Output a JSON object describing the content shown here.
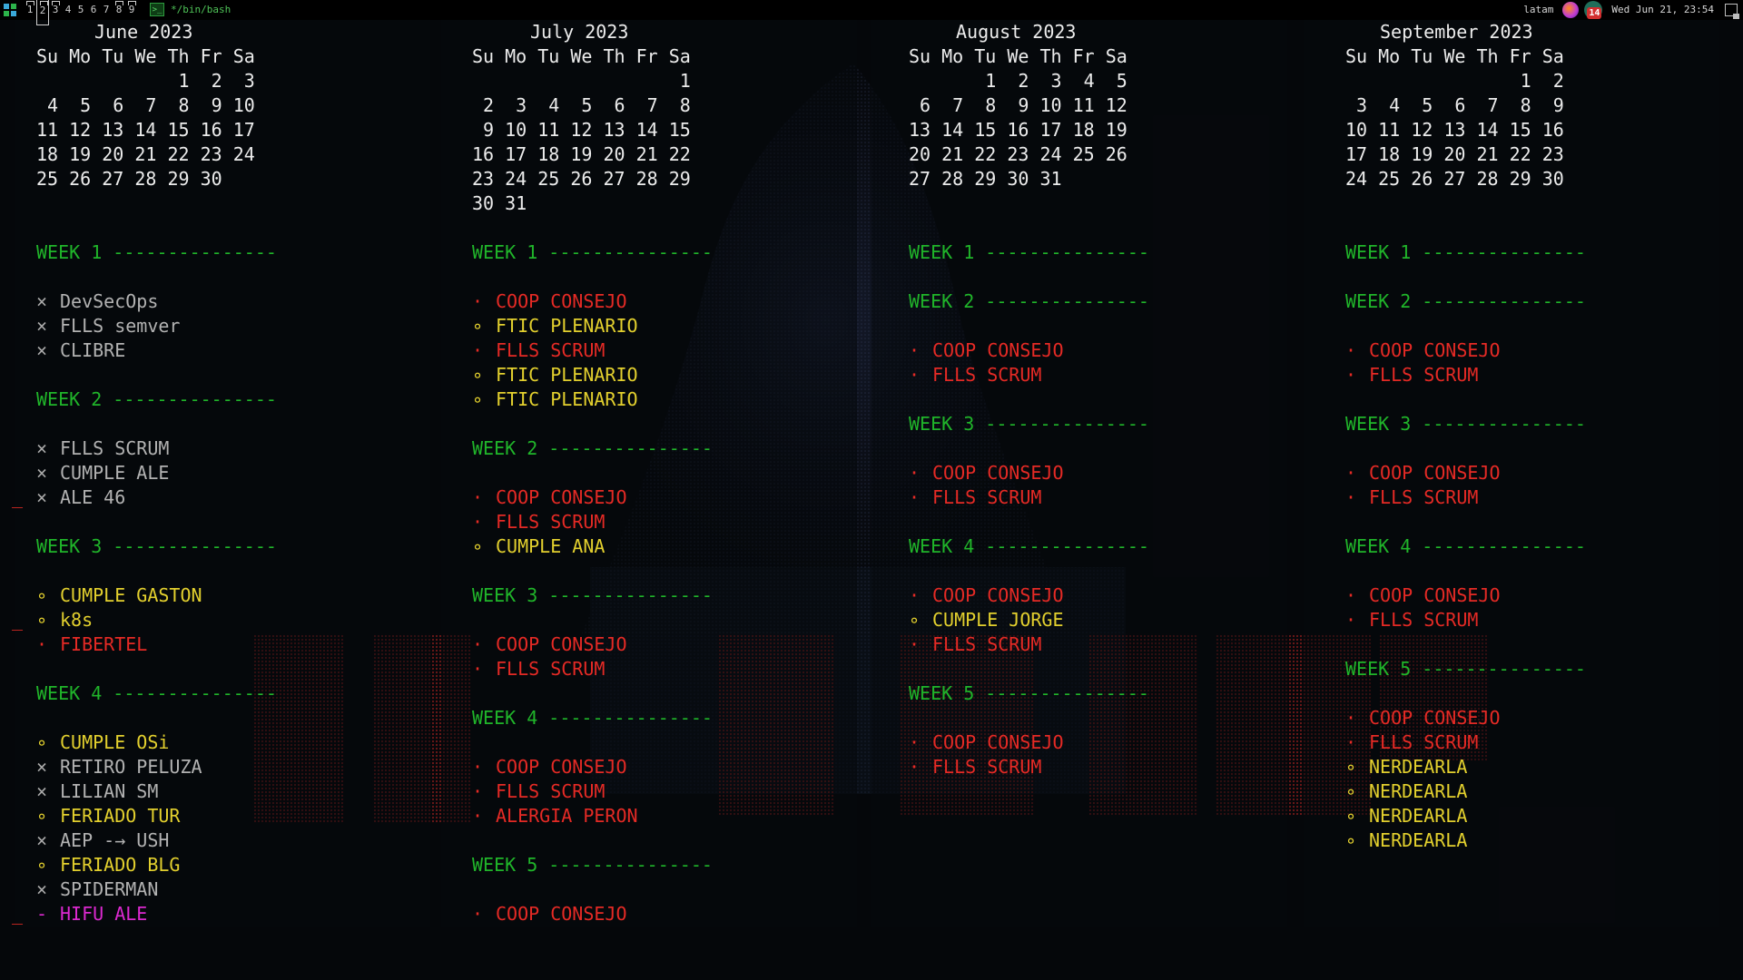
{
  "topbar": {
    "workspaces": [
      "1",
      "2",
      "3",
      "4",
      "5",
      "6",
      "7",
      "8",
      "9"
    ],
    "active_workspace": "2",
    "occupied_workspaces": [
      "1",
      "2",
      "3",
      "8",
      "9"
    ],
    "window_title": "*/bin/bash",
    "keyboard_layout": "latam",
    "notification_count": "14",
    "clock": "Wed Jun 21, 23:54"
  },
  "calendars": [
    {
      "month": "June 2023",
      "weekday_header": "Su Mo Tu We Th Fr Sa",
      "weeks": [
        "             1  2  3",
        " 4  5  6  7  8  9 10",
        "11 12 13 14 15 16 17",
        "18 19 20 21 22 23 24",
        "25 26 27 28 29 30"
      ],
      "sections": [
        {
          "label": "WEEK 1 ---------------",
          "events": [
            {
              "mark": "×",
              "text": "DevSecOps",
              "status": "done"
            },
            {
              "mark": "×",
              "text": "FLLS semver",
              "status": "done"
            },
            {
              "mark": "×",
              "text": "CLIBRE",
              "status": "done"
            }
          ]
        },
        {
          "label": "WEEK 2 ---------------",
          "events": [
            {
              "mark": "×",
              "text": "FLLS SCRUM",
              "status": "done"
            },
            {
              "mark": "×",
              "text": "CUMPLE ALE",
              "status": "done"
            },
            {
              "mark": "×",
              "text": "ALE 46",
              "status": "done",
              "flag": "_"
            }
          ]
        },
        {
          "label": "WEEK 3 ---------------",
          "events": [
            {
              "mark": "∘",
              "text": "CUMPLE GASTON",
              "status": "soon"
            },
            {
              "mark": "∘",
              "text": "k8s",
              "status": "soon",
              "flag": "_"
            },
            {
              "mark": "·",
              "text": "FIBERTEL",
              "status": "meet"
            }
          ]
        },
        {
          "label": "WEEK 4 ---------------",
          "events": [
            {
              "mark": "∘",
              "text": "CUMPLE OSi",
              "status": "soon"
            },
            {
              "mark": "×",
              "text": "RETIRO PELUZA",
              "status": "done"
            },
            {
              "mark": "×",
              "text": "LILIAN SM",
              "status": "done"
            },
            {
              "mark": "∘",
              "text": "FERIADO TUR",
              "status": "soon"
            },
            {
              "mark": "×",
              "text": "AEP -→ USH",
              "status": "done"
            },
            {
              "mark": "∘",
              "text": "FERIADO BLG",
              "status": "soon"
            },
            {
              "mark": "×",
              "text": "SPIDERMAN",
              "status": "done"
            },
            {
              "mark": "-",
              "text": "HIFU ALE",
              "status": "task",
              "flag": "_"
            }
          ]
        }
      ]
    },
    {
      "month": "July 2023",
      "weekday_header": "Su Mo Tu We Th Fr Sa",
      "weeks": [
        "                   1",
        " 2  3  4  5  6  7  8",
        " 9 10 11 12 13 14 15",
        "16 17 18 19 20 21 22",
        "23 24 25 26 27 28 29",
        "30 31"
      ],
      "sections": [
        {
          "label": "WEEK 1 ---------------",
          "events": [
            {
              "mark": "·",
              "text": "COOP CONSEJO",
              "status": "meet"
            },
            {
              "mark": "∘",
              "text": "FTIC PLENARIO",
              "status": "soon"
            },
            {
              "mark": "·",
              "text": "FLLS SCRUM",
              "status": "meet"
            },
            {
              "mark": "∘",
              "text": "FTIC PLENARIO",
              "status": "soon"
            },
            {
              "mark": "∘",
              "text": "FTIC PLENARIO",
              "status": "soon"
            }
          ]
        },
        {
          "label": "WEEK 2 ---------------",
          "events": [
            {
              "mark": "·",
              "text": "COOP CONSEJO",
              "status": "meet"
            },
            {
              "mark": "·",
              "text": "FLLS SCRUM",
              "status": "meet"
            },
            {
              "mark": "∘",
              "text": "CUMPLE ANA",
              "status": "soon"
            }
          ]
        },
        {
          "label": "WEEK 3 ---------------",
          "events": [
            {
              "mark": "·",
              "text": "COOP CONSEJO",
              "status": "meet"
            },
            {
              "mark": "·",
              "text": "FLLS SCRUM",
              "status": "meet"
            }
          ]
        },
        {
          "label": "WEEK 4 ---------------",
          "events": [
            {
              "mark": "·",
              "text": "COOP CONSEJO",
              "status": "meet"
            },
            {
              "mark": "·",
              "text": "FLLS SCRUM",
              "status": "meet"
            },
            {
              "mark": "·",
              "text": "ALERGIA PERON",
              "status": "meet"
            }
          ]
        },
        {
          "label": "WEEK 5 ---------------",
          "events": [
            {
              "mark": "·",
              "text": "COOP CONSEJO",
              "status": "meet"
            }
          ]
        }
      ]
    },
    {
      "month": "August 2023",
      "weekday_header": "Su Mo Tu We Th Fr Sa",
      "weeks": [
        "       1  2  3  4  5",
        " 6  7  8  9 10 11 12",
        "13 14 15 16 17 18 19",
        "20 21 22 23 24 25 26",
        "27 28 29 30 31"
      ],
      "sections": [
        {
          "label": "WEEK 1 ---------------",
          "events": []
        },
        {
          "label": "WEEK 2 ---------------",
          "events": [
            {
              "mark": "·",
              "text": "COOP CONSEJO",
              "status": "meet"
            },
            {
              "mark": "·",
              "text": "FLLS SCRUM",
              "status": "meet"
            }
          ]
        },
        {
          "label": "WEEK 3 ---------------",
          "events": [
            {
              "mark": "·",
              "text": "COOP CONSEJO",
              "status": "meet"
            },
            {
              "mark": "·",
              "text": "FLLS SCRUM",
              "status": "meet"
            }
          ]
        },
        {
          "label": "WEEK 4 ---------------",
          "events": [
            {
              "mark": "·",
              "text": "COOP CONSEJO",
              "status": "meet"
            },
            {
              "mark": "∘",
              "text": "CUMPLE JORGE",
              "status": "soon"
            },
            {
              "mark": "·",
              "text": "FLLS SCRUM",
              "status": "meet"
            }
          ]
        },
        {
          "label": "WEEK 5 ---------------",
          "events": [
            {
              "mark": "·",
              "text": "COOP CONSEJO",
              "status": "meet"
            },
            {
              "mark": "·",
              "text": "FLLS SCRUM",
              "status": "meet"
            }
          ]
        }
      ]
    },
    {
      "month": "September 2023",
      "weekday_header": "Su Mo Tu We Th Fr Sa",
      "weeks": [
        "                1  2",
        " 3  4  5  6  7  8  9",
        "10 11 12 13 14 15 16",
        "17 18 19 20 21 22 23",
        "24 25 26 27 28 29 30"
      ],
      "sections": [
        {
          "label": "WEEK 1 ---------------",
          "events": []
        },
        {
          "label": "WEEK 2 ---------------",
          "events": [
            {
              "mark": "·",
              "text": "COOP CONSEJO",
              "status": "meet"
            },
            {
              "mark": "·",
              "text": "FLLS SCRUM",
              "status": "meet"
            }
          ]
        },
        {
          "label": "WEEK 3 ---------------",
          "events": [
            {
              "mark": "·",
              "text": "COOP CONSEJO",
              "status": "meet"
            },
            {
              "mark": "·",
              "text": "FLLS SCRUM",
              "status": "meet"
            }
          ]
        },
        {
          "label": "WEEK 4 ---------------",
          "events": [
            {
              "mark": "·",
              "text": "COOP CONSEJO",
              "status": "meet"
            },
            {
              "mark": "·",
              "text": "FLLS SCRUM",
              "status": "meet"
            }
          ]
        },
        {
          "label": "WEEK 5 ---------------",
          "events": [
            {
              "mark": "·",
              "text": "COOP CONSEJO",
              "status": "meet"
            },
            {
              "mark": "·",
              "text": "FLLS SCRUM",
              "status": "meet"
            },
            {
              "mark": "∘",
              "text": "NERDEARLA",
              "status": "soon"
            },
            {
              "mark": "∘",
              "text": "NERDEARLA",
              "status": "soon"
            },
            {
              "mark": "∘",
              "text": "NERDEARLA",
              "status": "soon"
            },
            {
              "mark": "∘",
              "text": "NERDEARLA",
              "status": "soon"
            }
          ]
        }
      ]
    }
  ],
  "colors": {
    "week_heading": "#20b52a",
    "done": "#b2b2b2",
    "soon": "#e3d02e",
    "meeting": "#e52a25",
    "task": "#dc29d0"
  }
}
